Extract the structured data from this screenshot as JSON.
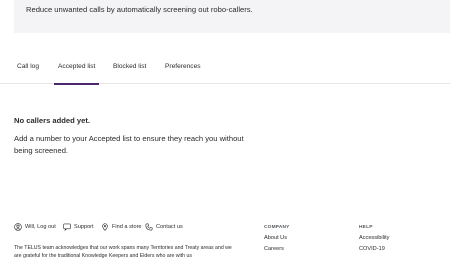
{
  "banner": {
    "text": "Reduce unwanted calls by automatically screening out robo-callers."
  },
  "tabs": [
    {
      "label": "Call log",
      "active": false
    },
    {
      "label": "Accepted list",
      "active": true
    },
    {
      "label": "Blocked list",
      "active": false
    },
    {
      "label": "Preferences",
      "active": false
    }
  ],
  "empty_state": {
    "title": "No callers added yet.",
    "description": "Add a number to your Accepted list to ensure they reach you without being screened."
  },
  "footer": {
    "links": [
      {
        "label": "Will, Log out",
        "icon": "user-icon"
      },
      {
        "label": "Support",
        "icon": "chat-icon"
      },
      {
        "label": "Find a store",
        "icon": "location-pin-icon"
      },
      {
        "label": "Contact us",
        "icon": "phone-icon"
      }
    ],
    "acknowledgement": "The TELUS team acknowledges that our work spans many Territories and Treaty areas and we are grateful for the traditional Knowledge Keepers and Elders who are with us",
    "company": {
      "title": "COMPANY",
      "items": [
        "About Us",
        "Careers"
      ]
    },
    "help": {
      "title": "HELP",
      "items": [
        "Accessibility",
        "COVID-19"
      ]
    }
  },
  "colors": {
    "accent": "#4b286d",
    "banner_bg": "#f4f4f7",
    "text": "#2a2c2e"
  }
}
